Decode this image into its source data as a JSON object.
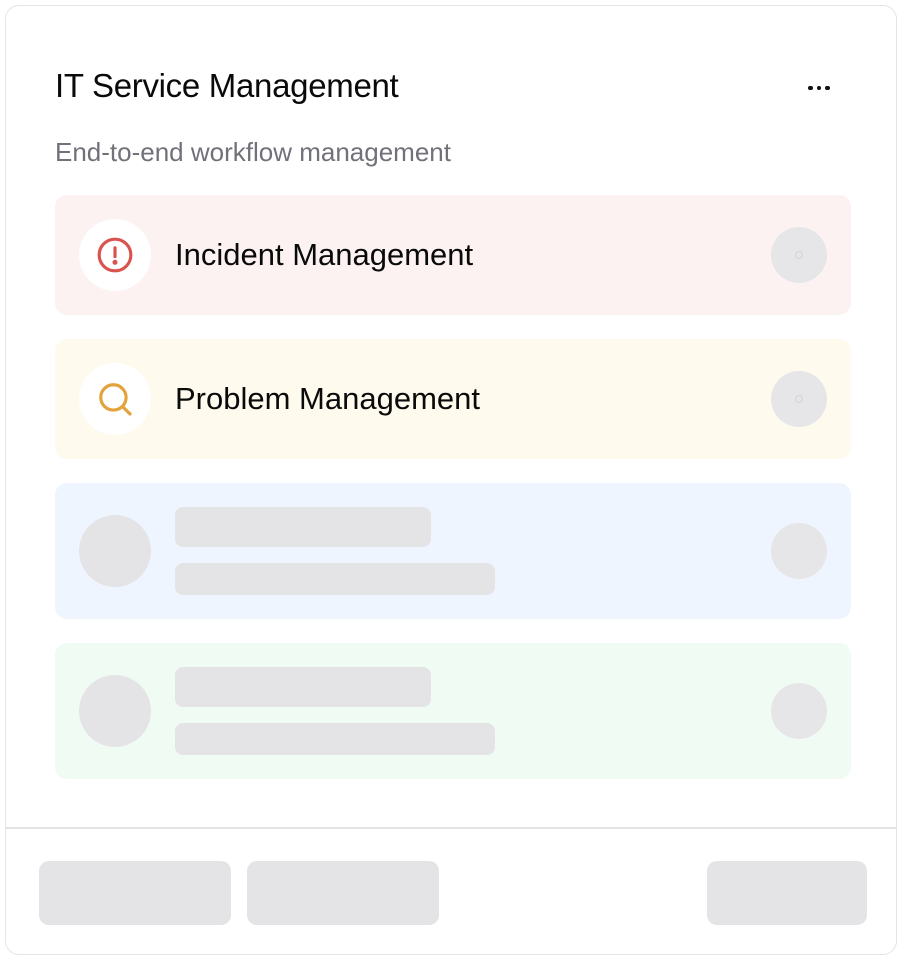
{
  "card": {
    "title": "IT Service Management",
    "subtitle": "End-to-end workflow management",
    "menu_icon": "more-horizontal-icon"
  },
  "items": [
    {
      "label": "Incident Management",
      "icon": "alert-circle-icon",
      "icon_color": "#d9534f",
      "background": "#fcf2f2",
      "state": "loaded"
    },
    {
      "label": "Problem Management",
      "icon": "search-icon",
      "icon_color": "#e3a23b",
      "background": "#fefaed",
      "state": "loaded"
    },
    {
      "label": "",
      "background": "#eff5fe",
      "state": "loading-skeleton"
    },
    {
      "label": "",
      "background": "#f0fbf3",
      "state": "loading-skeleton"
    }
  ],
  "footer": {
    "buttons_state": "loading-skeleton",
    "button_count": 3
  },
  "colors": {
    "skeleton": "#e4e4e7",
    "border": "#e4e4e7",
    "title_text": "#0a0a0a",
    "subtitle_text": "#71717a"
  }
}
